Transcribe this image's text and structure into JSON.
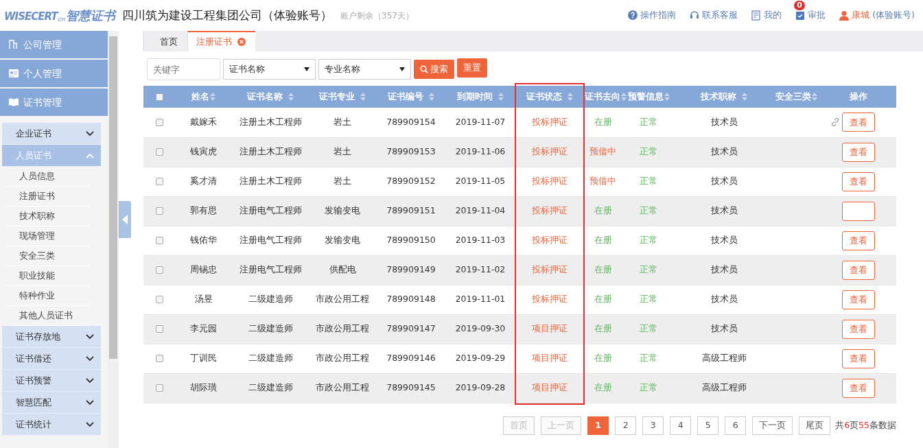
{
  "header": {
    "logo_text": "WISECERT",
    "logo_suffix": "cn",
    "logo_cn": "智慧证书",
    "company": "四川筑为建设工程集团公司（体验账号）",
    "account_remaining": "账户剩余（357天）",
    "links": [
      {
        "kind": "help",
        "label": "操作指南"
      },
      {
        "kind": "service",
        "label": "联系客服"
      },
      {
        "kind": "mine",
        "label": "我的"
      },
      {
        "kind": "approve",
        "label": "审批",
        "badge": "0"
      }
    ],
    "user": {
      "name": "康城",
      "note": "(体验账号)"
    }
  },
  "sidebar": {
    "sections": [
      {
        "kind": "company",
        "label": "公司管理"
      },
      {
        "kind": "personal",
        "label": "个人管理"
      },
      {
        "kind": "cert",
        "label": "证书管理"
      }
    ],
    "groups": [
      {
        "label": "企业证书",
        "expanded": false,
        "selected": false
      },
      {
        "label": "人员证书",
        "expanded": true,
        "selected": true,
        "children": [
          {
            "label": "人员信息"
          },
          {
            "label": "注册证书"
          },
          {
            "label": "技术职称"
          },
          {
            "label": "现场管理"
          },
          {
            "label": "安全三类"
          },
          {
            "label": "职业技能"
          },
          {
            "label": "特种作业"
          },
          {
            "label": "其他人员证书"
          }
        ]
      },
      {
        "label": "证书存放地",
        "expanded": false,
        "selected": false
      },
      {
        "label": "证书借还",
        "expanded": false,
        "selected": false
      },
      {
        "label": "证书预警",
        "expanded": false,
        "selected": false
      },
      {
        "label": "智慧匹配",
        "expanded": false,
        "selected": false
      },
      {
        "label": "证书统计",
        "expanded": false,
        "selected": false
      }
    ]
  },
  "tabs": [
    {
      "label": "首页",
      "selected": false,
      "closable": false
    },
    {
      "label": "注册证书",
      "selected": true,
      "closable": true
    }
  ],
  "filters": {
    "keyword": {
      "placeholder": "关键字"
    },
    "selects": [
      {
        "value": "证书名称"
      },
      {
        "value": "专业名称"
      }
    ],
    "search_button": "搜索",
    "reset_button": "重置"
  },
  "table": {
    "select_all_checked": false,
    "columns": [
      {
        "label": "姓名",
        "sortable": true,
        "highlighted": false
      },
      {
        "label": "证书名称",
        "sortable": true,
        "highlighted": false
      },
      {
        "label": "证书专业",
        "sortable": true,
        "highlighted": false
      },
      {
        "label": "证书编号",
        "sortable": true,
        "highlighted": false
      },
      {
        "label": "到期时间",
        "sortable": true,
        "highlighted": false
      },
      {
        "label": "证书状态",
        "sortable": true,
        "highlighted": true
      },
      {
        "label": "证书去向",
        "sortable": true,
        "highlighted": false
      },
      {
        "label": "预警信息",
        "sortable": true,
        "highlighted": false
      },
      {
        "label": "技术职称",
        "sortable": true,
        "highlighted": false
      },
      {
        "label": "安全三类",
        "sortable": true,
        "highlighted": false
      },
      {
        "label": "操作",
        "sortable": false,
        "highlighted": false
      }
    ],
    "rows": [
      {
        "checked": false,
        "name": "戴嫁禾",
        "cert": "注册土木工程师",
        "major": "岩土",
        "number": "789909154",
        "expiry": "2019-11-07",
        "status": "投标押证",
        "direction": {
          "text": "在册",
          "color": "#5cb85c"
        },
        "warning": "正常",
        "title": "技术员",
        "linked": true,
        "view": "查看"
      },
      {
        "checked": false,
        "name": "钱寅虎",
        "cert": "注册土木工程师",
        "major": "岩土",
        "number": "789909153",
        "expiry": "2019-11-06",
        "status": "投标押证",
        "direction": {
          "text": "预借中",
          "color": "#f0643c"
        },
        "warning": "正常",
        "title": "技术员",
        "linked": false,
        "view": "查看"
      },
      {
        "checked": false,
        "name": "奚才清",
        "cert": "注册土木工程师",
        "major": "岩土",
        "number": "789909152",
        "expiry": "2019-11-05",
        "status": "投标押证",
        "direction": {
          "text": "预借中",
          "color": "#f0643c"
        },
        "warning": "正常",
        "title": "技术员",
        "linked": false,
        "view": "查看"
      },
      {
        "checked": false,
        "name": "郭有思",
        "cert": "注册电气工程师",
        "major": "发输变电",
        "number": "789909151",
        "expiry": "2019-11-04",
        "status": "投标押证",
        "direction": {
          "text": "在册",
          "color": "#5cb85c"
        },
        "warning": "正常",
        "title": "技术员",
        "linked": false
      },
      {
        "checked": false,
        "name": "钱佑华",
        "cert": "注册电气工程师",
        "major": "发输变电",
        "number": "789909150",
        "expiry": "2019-11-03",
        "status": "投标押证",
        "direction": {
          "text": "在册",
          "color": "#5cb85c"
        },
        "warning": "正常",
        "title": "技术员",
        "linked": false,
        "view": "查看"
      },
      {
        "checked": false,
        "name": "周锡忠",
        "cert": "注册电气工程师",
        "major": "供配电",
        "number": "789909149",
        "expiry": "2019-11-02",
        "status": "投标押证",
        "direction": {
          "text": "在册",
          "color": "#5cb85c"
        },
        "warning": "正常",
        "title": "技术员",
        "linked": false,
        "view": "查看"
      },
      {
        "checked": false,
        "name": "汤昱",
        "cert": "二级建造师",
        "major": "市政公用工程",
        "number": "789909148",
        "expiry": "2019-11-01",
        "status": "投标押证",
        "direction": {
          "text": "在册",
          "color": "#5cb85c"
        },
        "warning": "正常",
        "title": "技术员",
        "linked": false,
        "view": "查看"
      },
      {
        "checked": false,
        "name": "李元园",
        "cert": "二级建造师",
        "major": "市政公用工程",
        "number": "789909147",
        "expiry": "2019-09-30",
        "status": "项目押证",
        "direction": {
          "text": "在册",
          "color": "#5cb85c"
        },
        "warning": "正常",
        "title": "技术员",
        "linked": false,
        "view": "查看"
      },
      {
        "checked": false,
        "name": "丁训民",
        "cert": "二级建造师",
        "major": "市政公用工程",
        "number": "789909146",
        "expiry": "2019-09-29",
        "status": "项目押证",
        "direction": {
          "text": "在册",
          "color": "#5cb85c"
        },
        "warning": "正常",
        "title": "高级工程师",
        "linked": false,
        "view": "查看"
      },
      {
        "checked": false,
        "name": "胡际璜",
        "cert": "二级建造师",
        "major": "市政公用工程",
        "number": "789909145",
        "expiry": "2019-09-28",
        "status": "项目押证",
        "direction": {
          "text": "在册",
          "color": "#5cb85c"
        },
        "warning": "正常",
        "title": "高级工程师",
        "linked": false,
        "view": "查看"
      }
    ]
  },
  "pagination": {
    "pages": [
      {
        "label": "首页",
        "disabled": true,
        "selected": false
      },
      {
        "label": "上一页",
        "disabled": true,
        "selected": false
      },
      {
        "label": "1",
        "disabled": false,
        "selected": true
      },
      {
        "label": "2",
        "disabled": false,
        "selected": false
      },
      {
        "label": "3",
        "disabled": false,
        "selected": false
      },
      {
        "label": "4",
        "disabled": false,
        "selected": false
      },
      {
        "label": "5",
        "disabled": false,
        "selected": false
      },
      {
        "label": "6",
        "disabled": false,
        "selected": false
      },
      {
        "label": "下一页",
        "disabled": false,
        "selected": false
      },
      {
        "label": "尾页",
        "disabled": false,
        "selected": false
      }
    ],
    "summary": [
      {
        "text": "共",
        "emphasis": false
      },
      {
        "text": "6",
        "emphasis": true
      },
      {
        "text": "页",
        "emphasis": false
      },
      {
        "text": "55",
        "emphasis": true
      },
      {
        "text": "条数据",
        "emphasis": false
      }
    ]
  }
}
